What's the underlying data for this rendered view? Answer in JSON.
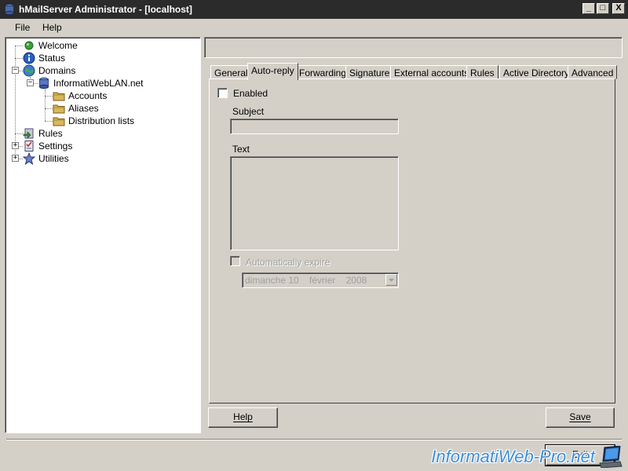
{
  "window": {
    "title": "hMailServer Administrator - [localhost]",
    "controls": {
      "minimize": "_",
      "maximize": "□",
      "close": "X"
    }
  },
  "menu": [
    "File",
    "Help"
  ],
  "tree": {
    "welcome": "Welcome",
    "status": "Status",
    "domains": "Domains",
    "domain": "InformatiWebLAN.net",
    "accounts": "Accounts",
    "aliases": "Aliases",
    "distribution_lists": "Distribution lists",
    "rules": "Rules",
    "settings": "Settings",
    "utilities": "Utilities"
  },
  "tabs": [
    "General",
    "Auto-reply",
    "Forwarding",
    "Signature",
    "External accounts",
    "Rules",
    "Active Directory",
    "Advanced"
  ],
  "active_tab": "Auto-reply",
  "autoreply": {
    "enabled_label": "Enabled",
    "subject_label": "Subject",
    "subject_value": "",
    "text_label": "Text",
    "text_value": "",
    "auto_expire_label": "Automatically expire",
    "expire_date": "dimanche 10    février    2008"
  },
  "buttons": {
    "help": "Help",
    "save": "Save",
    "exit": "Exit"
  },
  "watermark": "InformatiWeb-Pro.net",
  "colors": {
    "watermark": "#3a8fd8",
    "titlebar": "#2b2b2b"
  }
}
